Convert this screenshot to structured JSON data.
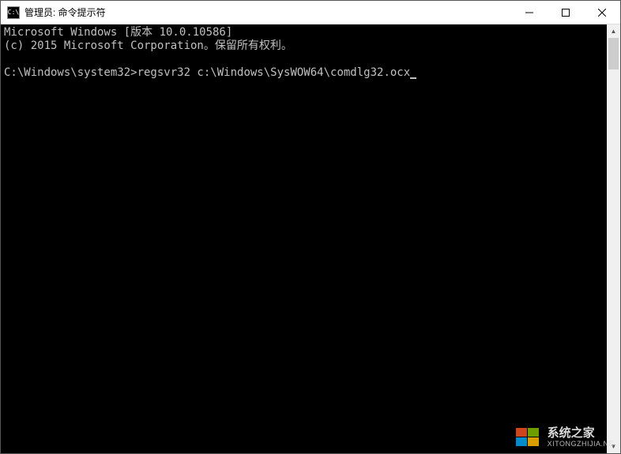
{
  "titlebar": {
    "icon_text": "C:\\",
    "title": "管理员: 命令提示符"
  },
  "console": {
    "line1": "Microsoft Windows [版本 10.0.10586]",
    "line2": "(c) 2015 Microsoft Corporation。保留所有权利。",
    "blank": "",
    "prompt": "C:\\Windows\\system32>",
    "command": "regsvr32 c:\\Windows\\SysWOW64\\comdlg32.ocx"
  },
  "watermark": {
    "title": "系统之家",
    "sub": "XITONGZHIJIA.NE"
  }
}
